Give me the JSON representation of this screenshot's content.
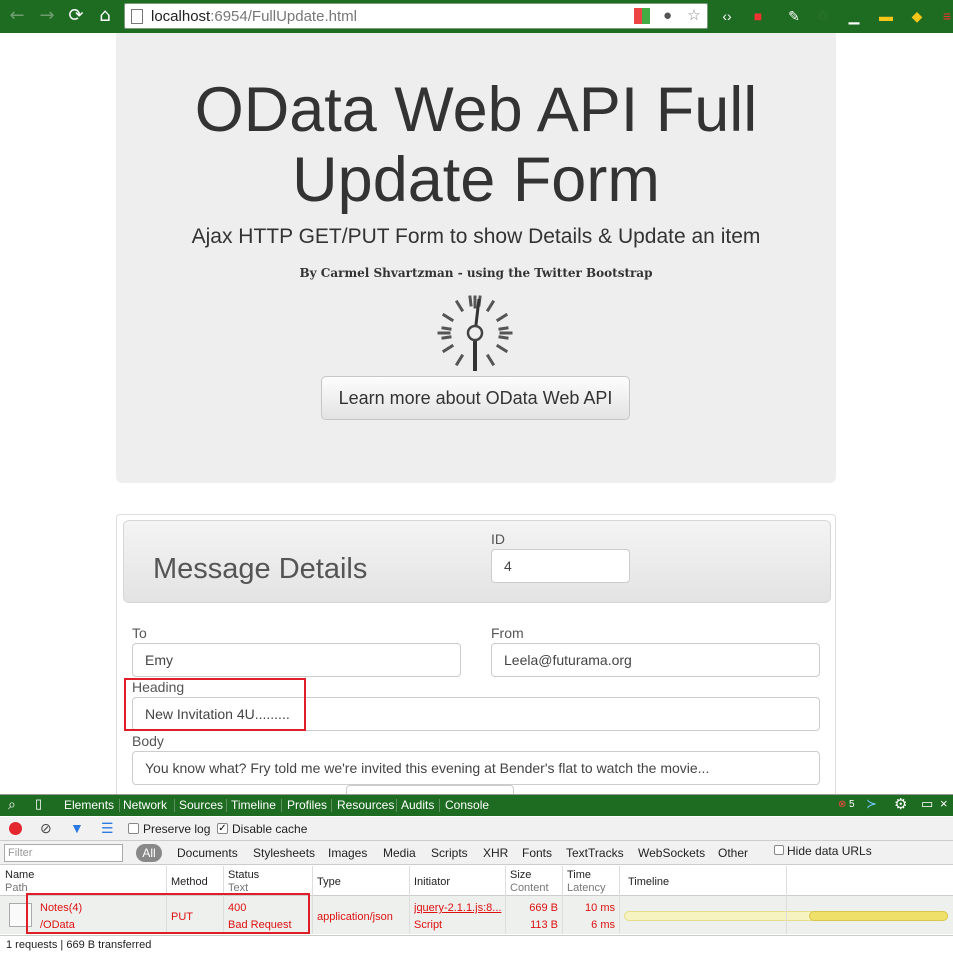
{
  "browser": {
    "url_host": "localhost",
    "url_path": ":6954/FullUpdate.html"
  },
  "jumbotron": {
    "title_line1": "OData Web API Full",
    "title_line2": "Update Form",
    "subtitle": "Ajax HTTP GET/PUT Form to show Details & Update an item",
    "author": "By Carmel Shvartzman - using the Twitter Bootstrap",
    "button_label": "Learn more about OData Web API"
  },
  "form": {
    "panel_title": "Message Details",
    "id_label": "ID",
    "id_value": "4",
    "to_label": "To",
    "to_value": "Emy",
    "from_label": "From",
    "from_value": "Leela@futurama.org",
    "heading_label": "Heading",
    "heading_value": "New Invitation 4U.........",
    "body_label": "Body",
    "body_value": "You know what? Fry told me we're invited this evening at Bender's flat to watch the movie..."
  },
  "devtools": {
    "tabs": [
      "Elements",
      "Network",
      "Sources",
      "Timeline",
      "Profiles",
      "Resources",
      "Audits",
      "Console"
    ],
    "error_count": "5",
    "preserve_log": "Preserve log",
    "disable_cache": "Disable cache",
    "filter_placeholder": "Filter",
    "filter_types": [
      "All",
      "Documents",
      "Stylesheets",
      "Images",
      "Media",
      "Scripts",
      "XHR",
      "Fonts",
      "TextTracks",
      "WebSockets",
      "Other"
    ],
    "hide_data_urls": "Hide data URLs",
    "columns": {
      "name": "Name",
      "path": "Path",
      "method": "Method",
      "status": "Status",
      "text": "Text",
      "type": "Type",
      "initiator": "Initiator",
      "size": "Size",
      "content": "Content",
      "time": "Time",
      "latency": "Latency",
      "timeline": "Timeline"
    },
    "request": {
      "name": "Notes(4)",
      "path": "/OData",
      "method": "PUT",
      "status": "400",
      "status_text": "Bad Request",
      "type": "application/json",
      "initiator": "jquery-2.1.1.js:8...",
      "initiator_type": "Script",
      "size": "669 B",
      "content": "113 B",
      "time": "10 ms",
      "latency": "6 ms"
    },
    "summary": "1 requests | 669 B transferred"
  },
  "colors": {
    "browser_chrome": "#1e6b22",
    "highlight": "#e01e2a",
    "error_text": "#dd1111"
  }
}
